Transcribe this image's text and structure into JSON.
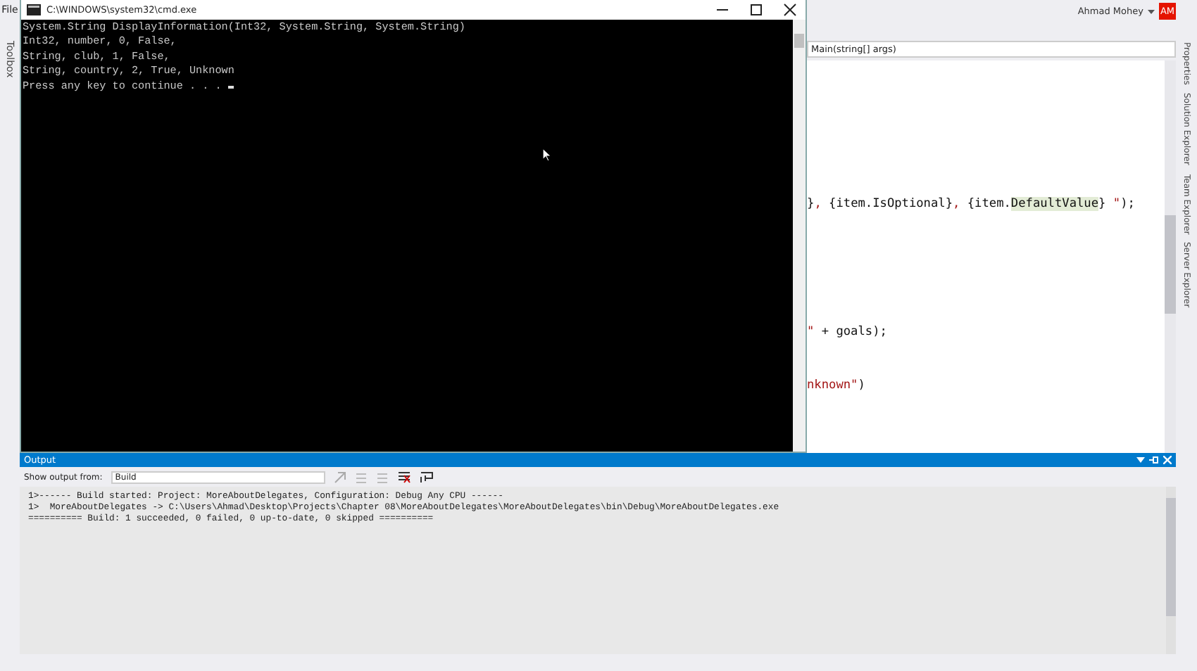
{
  "ide": {
    "menu_first": "File",
    "toolbox_tab": "Toolbox",
    "user_name": "Ahmad Mohey",
    "user_initials": "AM"
  },
  "console": {
    "title": "C:\\WINDOWS\\system32\\cmd.exe",
    "lines": [
      "System.String DisplayInformation(Int32, System.String, System.String)",
      "Int32, number, 0, False,",
      "String, club, 1, False,",
      "String, country, 2, True, Unknown",
      "Press any key to continue . . . "
    ]
  },
  "editor": {
    "member_dropdown": "Main(string[] args)",
    "code_lines": [
      [
        {
          "text": "}",
          "kind": "code"
        },
        {
          "text": ",",
          "kind": "string"
        },
        {
          "text": " {item.IsOptional}",
          "kind": "code"
        },
        {
          "text": ",",
          "kind": "string"
        },
        {
          "text": " {item.",
          "kind": "code"
        },
        {
          "text": "DefaultValue",
          "kind": "highlight"
        },
        {
          "text": "} ",
          "kind": "code"
        },
        {
          "text": "\"",
          "kind": "string"
        },
        {
          "text": ");",
          "kind": "code"
        }
      ],
      [
        {
          "text": "\"",
          "kind": "string"
        },
        {
          "text": " + goals);",
          "kind": "code"
        }
      ],
      [
        {
          "text": "nknown\"",
          "kind": "string"
        },
        {
          "text": ")",
          "kind": "code"
        }
      ]
    ]
  },
  "side_tabs": [
    "Properties",
    "Solution Explorer",
    "Team Explorer",
    "Server Explorer"
  ],
  "output": {
    "title": "Output",
    "show_from_label": "Show output from:",
    "source": "Build",
    "lines": [
      "1>------ Build started: Project: MoreAboutDelegates, Configuration: Debug Any CPU ------",
      "1>  MoreAboutDelegates -> C:\\Users\\Ahmad\\Desktop\\Projects\\Chapter 08\\MoreAboutDelegates\\MoreAboutDelegates\\bin\\Debug\\MoreAboutDelegates.exe",
      "========== Build: 1 succeeded, 0 failed, 0 up-to-date, 0 skipped =========="
    ]
  }
}
